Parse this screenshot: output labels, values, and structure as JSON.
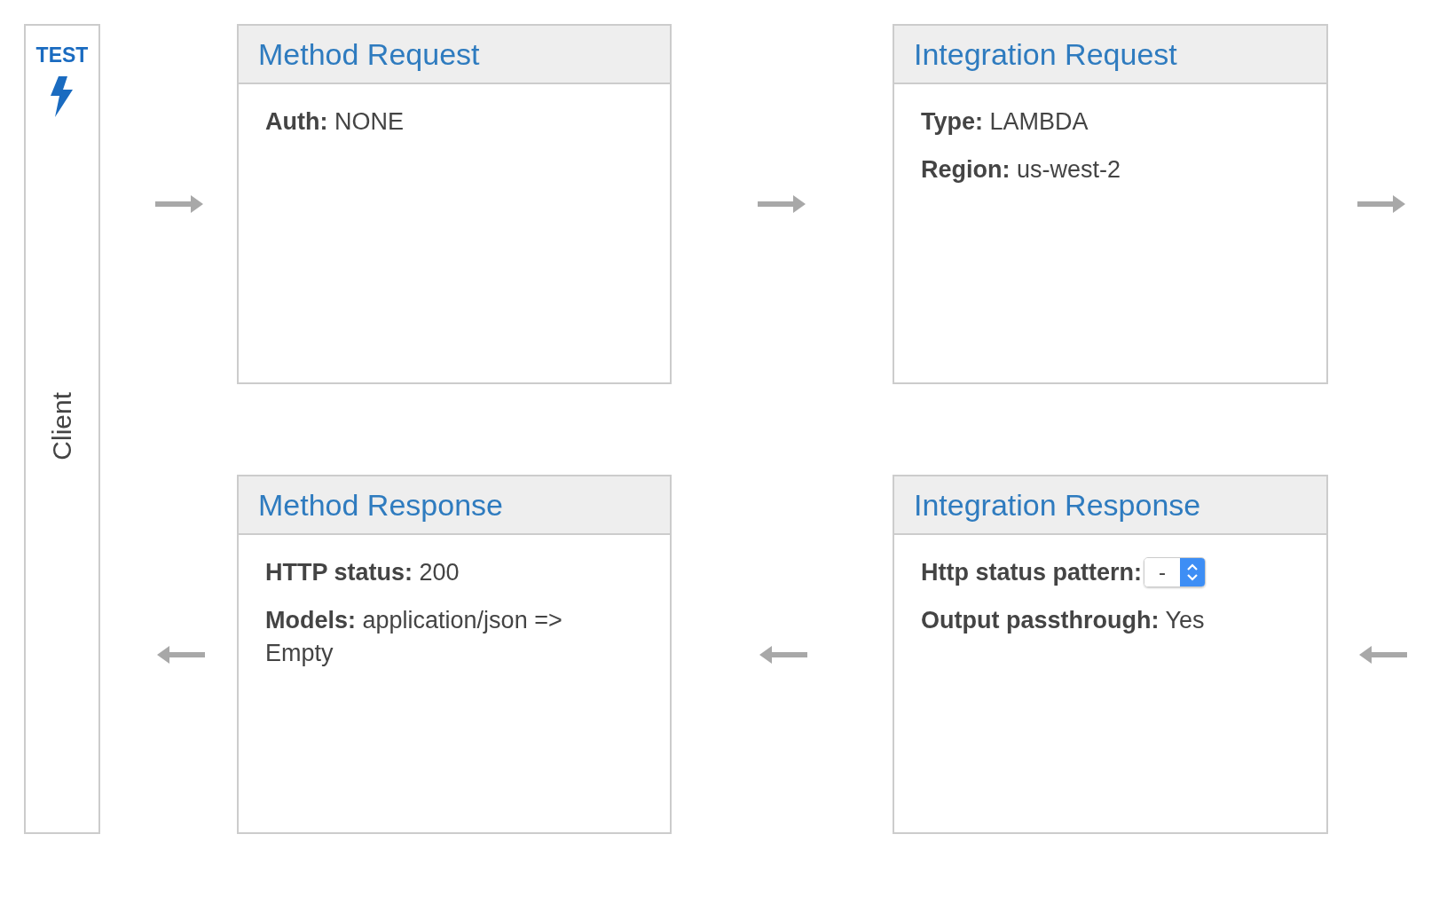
{
  "client": {
    "test_label": "TEST",
    "label": "Client"
  },
  "cards": [
    {
      "title": "Method Request",
      "fields": [
        {
          "kind": "text",
          "label": "Auth:",
          "value": "NONE"
        }
      ]
    },
    {
      "title": "Integration Request",
      "fields": [
        {
          "kind": "text",
          "label": "Type:",
          "value": "LAMBDA"
        },
        {
          "kind": "text",
          "label": "Region:",
          "value": "us-west-2"
        }
      ]
    },
    {
      "title": "Method Response",
      "fields": [
        {
          "kind": "text",
          "label": "HTTP status:",
          "value": "200"
        },
        {
          "kind": "text",
          "label": "Models:",
          "value": "application/json => Empty"
        }
      ]
    },
    {
      "title": "Integration Response",
      "fields": [
        {
          "kind": "select",
          "label": "Http status pattern:",
          "selection": "-"
        },
        {
          "kind": "text",
          "label": "Output passthrough:",
          "value": "Yes"
        }
      ]
    }
  ]
}
